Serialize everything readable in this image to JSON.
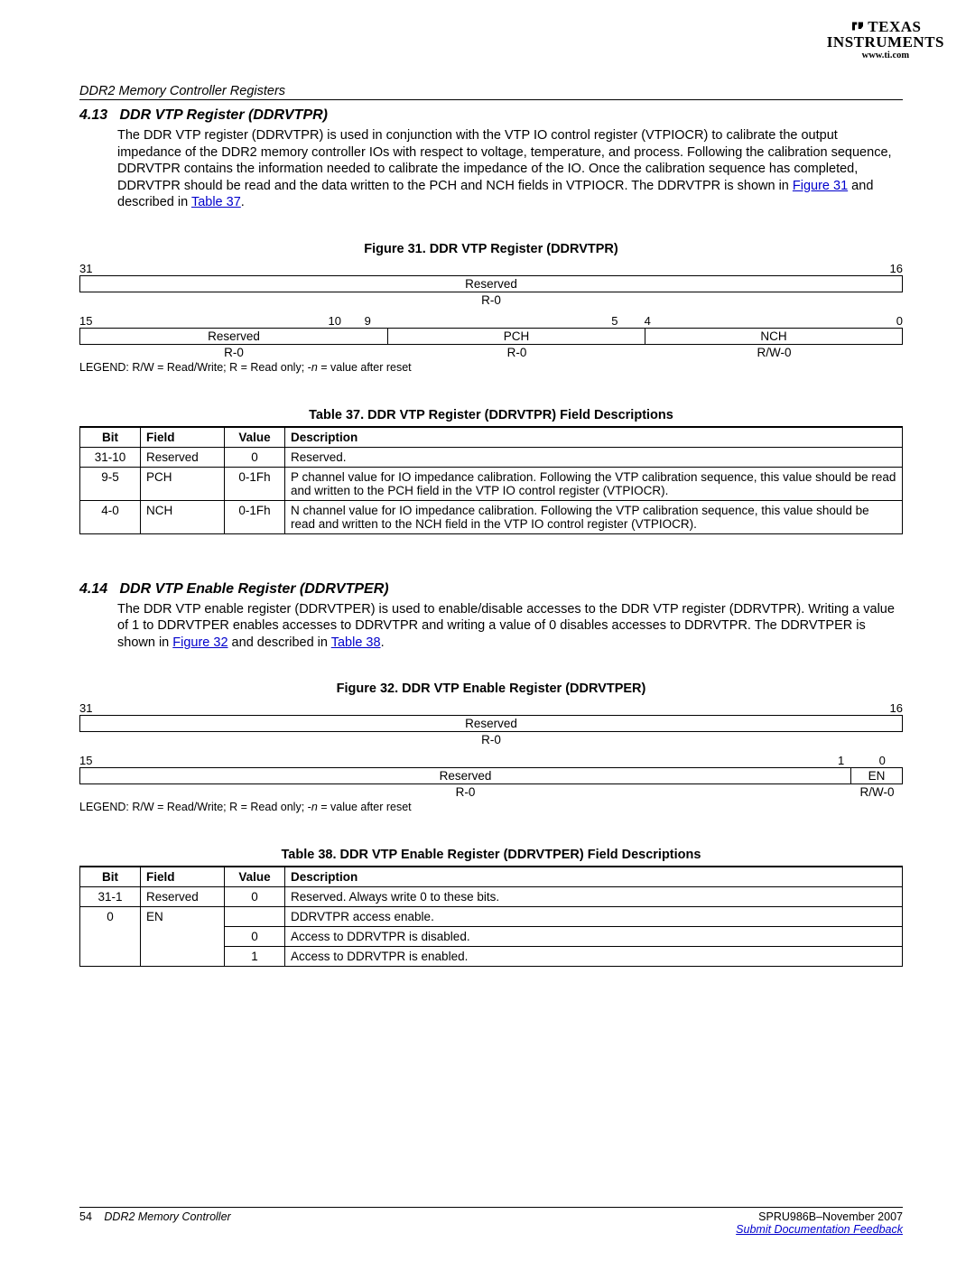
{
  "logo": {
    "line1": "TEXAS",
    "line2": "INSTRUMENTS",
    "url": "www.ti.com"
  },
  "header_chapter": "DDR2 Memory Controller Registers",
  "section413": {
    "num": "4.13",
    "title": "DDR VTP Register (DDRVTPR)",
    "para_a": "The DDR VTP register (DDRVTPR) is used in conjunction with the VTP IO control register (VTPIOCR) to calibrate the output impedance of the DDR2 memory controller IOs with respect to voltage, temperature, and process. Following the calibration sequence, DDRVTPR contains the information needed to calibrate the impedance of the IO. Once the calibration sequence has completed, DDRVTPR should be read and the data written to the PCH and NCH fields in VTPIOCR. The DDRVTPR is shown in ",
    "link1": "Figure 31",
    "para_b": " and described in ",
    "link2": "Table 37",
    "para_c": "."
  },
  "fig31_title": "Figure 31. DDR VTP Register (DDRVTPR)",
  "fig31": {
    "top_left": "31",
    "top_right": "16",
    "row1": "Reserved",
    "row1_rw": "R-0",
    "b15": "15",
    "b10": "10",
    "b9": "9",
    "b5": "5",
    "b4": "4",
    "b0": "0",
    "c1": "Reserved",
    "c2": "PCH",
    "c3": "NCH",
    "rw1": "R-0",
    "rw2": "R-0",
    "rw3": "R/W-0"
  },
  "legend_text_a": "LEGEND: R/W = Read/Write; R = Read only; -",
  "legend_text_b": " = value after reset",
  "tbl37_title": "Table 37. DDR VTP Register (DDRVTPR) Field Descriptions",
  "tbl37": {
    "h1": "Bit",
    "h2": "Field",
    "h3": "Value",
    "h4": "Description",
    "rows": [
      {
        "bit": "31-10",
        "field": "Reserved",
        "value": "0",
        "desc": "Reserved."
      },
      {
        "bit": "9-5",
        "field": "PCH",
        "value": "0-1Fh",
        "desc": "P channel value for IO impedance calibration. Following the VTP calibration sequence, this value should be read and written to the PCH field in the VTP IO control register (VTPIOCR)."
      },
      {
        "bit": "4-0",
        "field": "NCH",
        "value": "0-1Fh",
        "desc": "N channel value for IO impedance calibration. Following the VTP calibration sequence, this value should be read and written to the NCH field in the VTP IO control register (VTPIOCR)."
      }
    ]
  },
  "section414": {
    "num": "4.14",
    "title": "DDR VTP Enable Register (DDRVTPER)",
    "para_a": "The DDR VTP enable register (DDRVTPER) is used to enable/disable accesses to the DDR VTP register (DDRVTPR). Writing a value of 1 to DDRVTPER enables accesses to DDRVTPR and writing a value of 0 disables accesses to DDRVTPR. The DDRVTPER is shown in ",
    "link1": "Figure 32",
    "para_b": " and described in ",
    "link2": "Table 38",
    "para_c": "."
  },
  "fig32_title": "Figure 32. DDR VTP Enable Register (DDRVTPER)",
  "fig32": {
    "top_left": "31",
    "top_right": "16",
    "row1": "Reserved",
    "row1_rw": "R-0",
    "b15": "15",
    "b1": "1",
    "b0": "0",
    "c1": "Reserved",
    "c2": "EN",
    "rw1": "R-0",
    "rw2": "R/W-0"
  },
  "tbl38_title": "Table 38. DDR VTP Enable Register (DDRVTPER) Field Descriptions",
  "tbl38": {
    "h1": "Bit",
    "h2": "Field",
    "h3": "Value",
    "h4": "Description",
    "rows": [
      {
        "bit": "31-1",
        "field": "Reserved",
        "value": "0",
        "desc": "Reserved. Always write 0 to these bits."
      },
      {
        "bit": "0",
        "field": "EN",
        "value": "",
        "desc": "DDRVTPR access enable."
      },
      {
        "bit": "",
        "field": "",
        "value": "0",
        "desc": "Access to DDRVTPR is disabled."
      },
      {
        "bit": "",
        "field": "",
        "value": "1",
        "desc": "Access to DDRVTPR is enabled."
      }
    ]
  },
  "footer": {
    "page": "54",
    "title": "DDR2 Memory Controller",
    "doc": "SPRU986B–November 2007",
    "feedback": "Submit Documentation Feedback"
  }
}
